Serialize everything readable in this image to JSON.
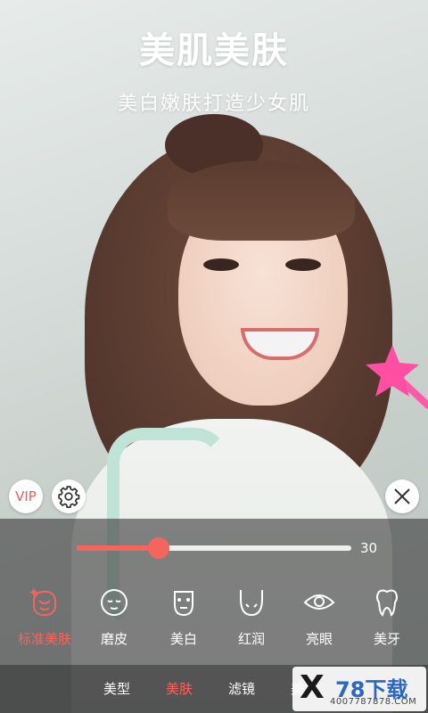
{
  "headline": {
    "title": "美肌美肤",
    "subtitle": "美白嫩肤打造少女肌"
  },
  "buttons": {
    "vip_label": "VIP"
  },
  "slider": {
    "value": 30,
    "max": 100,
    "value_label": "30"
  },
  "tools": [
    {
      "label": "标准美肤",
      "icon": "face-sparkle-icon",
      "active": true
    },
    {
      "label": "磨皮",
      "icon": "smooth-face-icon",
      "active": false
    },
    {
      "label": "美白",
      "icon": "whitening-mask-icon",
      "active": false
    },
    {
      "label": "红润",
      "icon": "rosy-face-icon",
      "active": false
    },
    {
      "label": "亮眼",
      "icon": "eye-icon",
      "active": false
    },
    {
      "label": "美牙",
      "icon": "tooth-icon",
      "active": false
    }
  ],
  "tabs": [
    {
      "label": "美型",
      "active": false
    },
    {
      "label": "美肤",
      "active": true
    },
    {
      "label": "滤镜",
      "active": false
    },
    {
      "label": "美妆",
      "active": false
    }
  ],
  "watermark": {
    "mark": "X",
    "brand": "78下载",
    "url": "4007787878.COM"
  },
  "colors": {
    "accent": "#f5655d",
    "panel": "#3c3c3c"
  }
}
